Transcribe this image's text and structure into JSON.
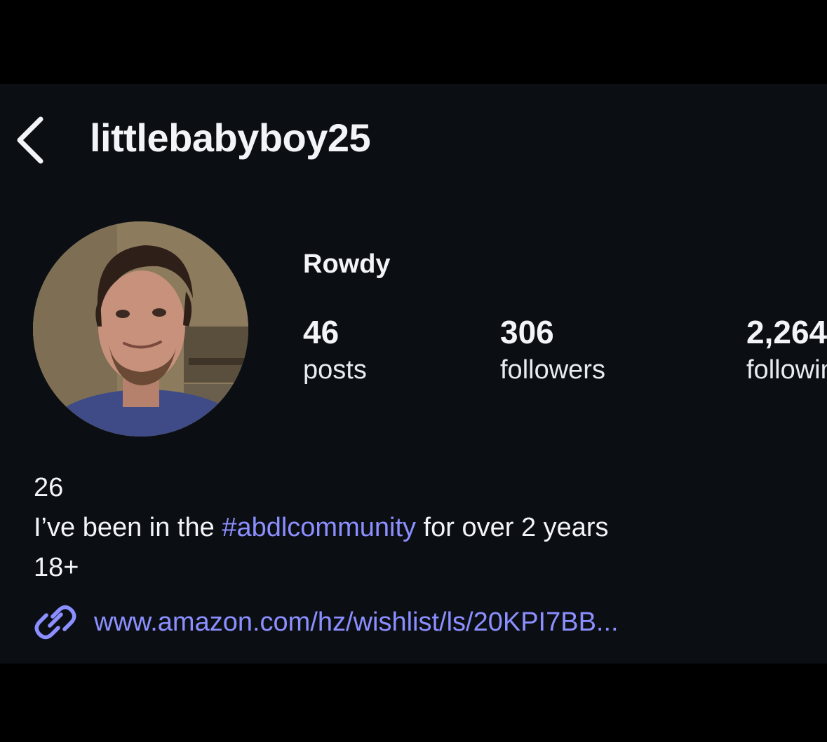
{
  "header": {
    "username": "littlebabyboy25",
    "back_icon": "chevron-left-icon"
  },
  "profile": {
    "display_name": "Rowdy",
    "stats": [
      {
        "value": "46",
        "label": "posts"
      },
      {
        "value": "306",
        "label": "followers"
      },
      {
        "value": "2,264",
        "label": "following"
      }
    ]
  },
  "bio": {
    "line1": "26",
    "line2_prefix": "I’ve been in the ",
    "line2_hashtag": "#abdlcommunity",
    "line2_suffix": " for over 2 years",
    "line3": "18+"
  },
  "link": {
    "icon": "link-icon",
    "text": "www.amazon.com/hz/wishlist/ls/20KPI7BB..."
  },
  "colors": {
    "background": "#0b0f14",
    "outer_frame": "#000000",
    "text": "#f2f4f7",
    "accent_link": "#8c8fff"
  }
}
